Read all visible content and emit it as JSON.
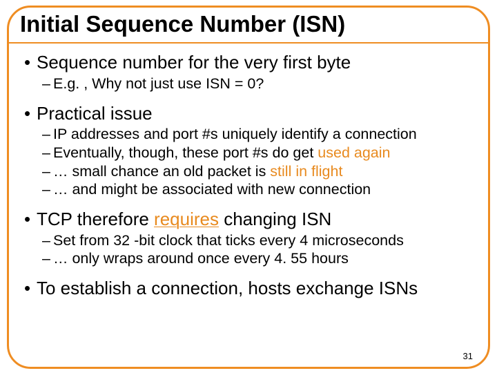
{
  "title": "Initial Sequence Number (ISN)",
  "bullets": {
    "a": {
      "text": "Sequence number for the very first byte",
      "subs": {
        "a1": "E.g. , Why not just use ISN = 0?"
      }
    },
    "b": {
      "text": "Practical issue",
      "subs": {
        "b1": "IP addresses and port #s uniquely identify a connection",
        "b2a": "Eventually, though, these port #s do get ",
        "b2b": "used again",
        "b3a": "… small chance an old packet is ",
        "b3b": "still in flight",
        "b4": "… and might be associated with new connection"
      }
    },
    "c": {
      "pre": "TCP therefore ",
      "req": "requires",
      "post": " changing ISN",
      "subs": {
        "c1": "Set from 32 -bit clock that ticks every 4 microseconds",
        "c2": "… only wraps around once every 4. 55 hours"
      }
    },
    "d": {
      "text": "To establish a connection, hosts exchange ISNs"
    }
  },
  "page_number": "31",
  "glyphs": {
    "bullet": "•",
    "dash": "–"
  }
}
